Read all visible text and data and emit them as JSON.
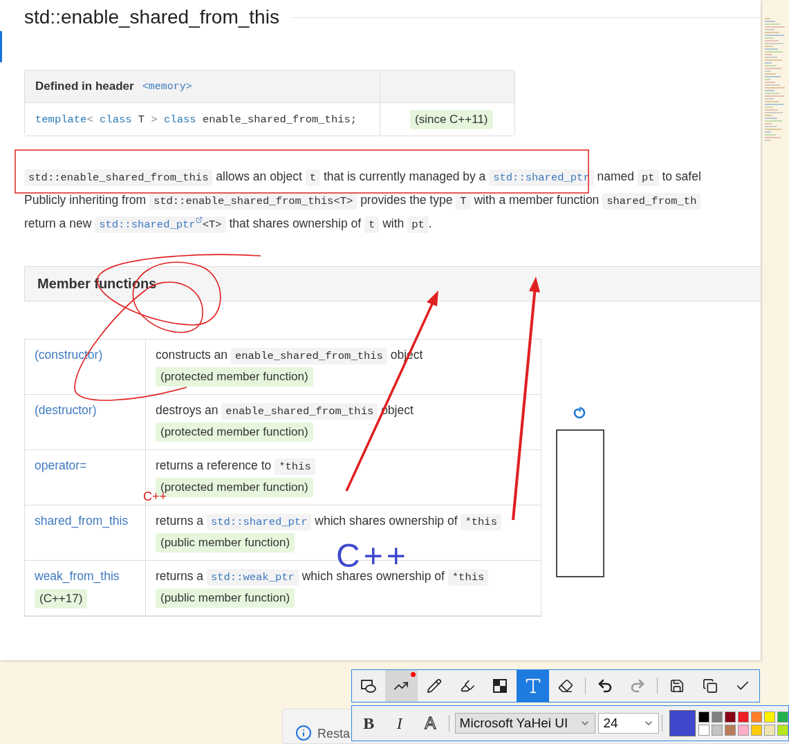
{
  "document": {
    "title": "std::enable_shared_from_this",
    "header_table": {
      "label": "Defined in header",
      "header": "<memory>",
      "declaration": [
        {
          "kind": "kw",
          "text": "template"
        },
        {
          "kind": "punct",
          "text": "< "
        },
        {
          "kind": "kw",
          "text": "class"
        },
        {
          "kind": "plain",
          "text": " T "
        },
        {
          "kind": "punct",
          "text": "> "
        },
        {
          "kind": "kw",
          "text": "class"
        },
        {
          "kind": "plain",
          "text": " enable_shared_from_this;"
        }
      ],
      "since": "(since C++11)"
    },
    "paragraphs": [
      [
        {
          "kind": "code",
          "text": "std::enable_shared_from_this"
        },
        {
          "kind": "text",
          "text": " allows an object "
        },
        {
          "kind": "code",
          "text": "t"
        },
        {
          "kind": "text",
          "text": " that is currently managed by a "
        },
        {
          "kind": "code_link",
          "text": "std::shared_ptr"
        },
        {
          "kind": "text",
          "text": " named "
        },
        {
          "kind": "code",
          "text": "pt"
        },
        {
          "kind": "text",
          "text": " to safel"
        }
      ],
      [
        {
          "kind": "text",
          "text": "Publicly inheriting from "
        },
        {
          "kind": "code",
          "text": "std::enable_shared_from_this<T>"
        },
        {
          "kind": "text",
          "text": " provides the type "
        },
        {
          "kind": "code",
          "text": "T"
        },
        {
          "kind": "text",
          "text": " with a member function "
        },
        {
          "kind": "code",
          "text": "shared_from_th"
        }
      ],
      [
        {
          "kind": "text",
          "text": "return a new "
        },
        {
          "kind": "code_link",
          "text": "std::shared_ptr",
          "after": "<T>",
          "external": true
        },
        {
          "kind": "text",
          "text": " that shares ownership of "
        },
        {
          "kind": "code",
          "text": "t"
        },
        {
          "kind": "text",
          "text": " with "
        },
        {
          "kind": "code",
          "text": "pt"
        },
        {
          "kind": "text",
          "text": "."
        }
      ]
    ],
    "section": "Member functions",
    "members": [
      {
        "name": "(constructor)",
        "description": [
          {
            "kind": "text",
            "text": "constructs an "
          },
          {
            "kind": "code",
            "text": "enable_shared_from_this"
          },
          {
            "kind": "text",
            "text": " object"
          }
        ],
        "note": "(protected member function)"
      },
      {
        "name": "(destructor)",
        "description": [
          {
            "kind": "text",
            "text": "destroys an "
          },
          {
            "kind": "code",
            "text": "enable_shared_from_this"
          },
          {
            "kind": "text",
            "text": " object"
          }
        ],
        "note": "(protected member function)"
      },
      {
        "name": "operator=",
        "description": [
          {
            "kind": "text",
            "text": "returns a reference to "
          },
          {
            "kind": "code",
            "text": "*this"
          }
        ],
        "note": "(protected member function)"
      },
      {
        "name": "shared_from_this",
        "description": [
          {
            "kind": "text",
            "text": "returns a "
          },
          {
            "kind": "code_link",
            "text": "std::shared_ptr"
          },
          {
            "kind": "text",
            "text": " which shares ownership of "
          },
          {
            "kind": "code",
            "text": "*this"
          }
        ],
        "note": "(public member function)"
      },
      {
        "name": "weak_from_this",
        "badge": "(C++17)",
        "description": [
          {
            "kind": "text",
            "text": "returns a "
          },
          {
            "kind": "code_link",
            "text": "std::weak_ptr"
          },
          {
            "kind": "text",
            "text": " which shares ownership of "
          },
          {
            "kind": "code",
            "text": "*this"
          }
        ],
        "note": "(public member function)"
      }
    ]
  },
  "annotations": {
    "large_text": "C++",
    "small_text": "C++"
  },
  "notification": {
    "text": "Resta"
  },
  "toolbar": {
    "tool_groups": [
      [
        {
          "kind": "shape",
          "selected": false
        },
        {
          "kind": "line",
          "selected": false,
          "hovered": true,
          "dot": true
        },
        {
          "kind": "pencil",
          "selected": false
        },
        {
          "kind": "marker",
          "selected": false
        },
        {
          "kind": "mosaic",
          "selected": false
        },
        {
          "kind": "text",
          "selected": true
        },
        {
          "kind": "eraser",
          "selected": false
        }
      ],
      [
        {
          "kind": "undo",
          "selected": false,
          "disabled": false
        },
        {
          "kind": "redo",
          "selected": false,
          "disabled": true
        }
      ],
      [
        {
          "kind": "save",
          "selected": false
        },
        {
          "kind": "copy",
          "selected": false
        },
        {
          "kind": "done",
          "selected": false
        }
      ]
    ]
  },
  "format_bar": {
    "style_buttons": [
      {
        "kind": "bold",
        "label": "B"
      },
      {
        "kind": "italic",
        "label": "I"
      },
      {
        "kind": "outline",
        "label": "A"
      }
    ],
    "font": "Microsoft YaHei UI",
    "size": "24",
    "current": {
      "color": "#3f48cc"
    },
    "palette": [
      {
        "color": "#000000"
      },
      {
        "color": "#7f7f7f"
      },
      {
        "color": "#880015"
      },
      {
        "color": "#ed1c24"
      },
      {
        "color": "#ff7f27"
      },
      {
        "color": "#fff200"
      },
      {
        "color": "#22b14c"
      },
      {
        "color": "#ffffff"
      },
      {
        "color": "#c3c3c3"
      },
      {
        "color": "#b97a57"
      },
      {
        "color": "#ffaec9"
      },
      {
        "color": "#ffc90e"
      },
      {
        "color": "#efe4b0"
      },
      {
        "color": "#b5e61d"
      }
    ]
  }
}
